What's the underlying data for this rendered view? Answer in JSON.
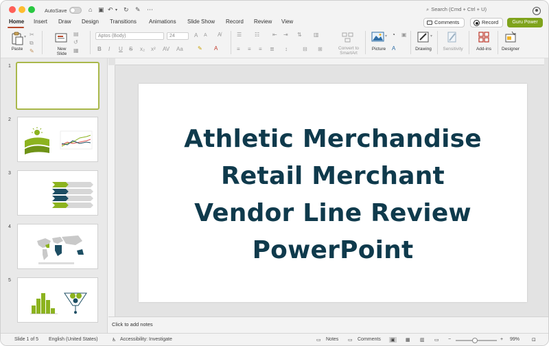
{
  "titlebar": {
    "autosave_label": "AutoSave",
    "search_placeholder": "Search (Cmd + Ctrl + U)"
  },
  "tabs": [
    {
      "label": "Home",
      "active": true
    },
    {
      "label": "Insert"
    },
    {
      "label": "Draw"
    },
    {
      "label": "Design"
    },
    {
      "label": "Transitions"
    },
    {
      "label": "Animations"
    },
    {
      "label": "Slide Show"
    },
    {
      "label": "Record"
    },
    {
      "label": "Review"
    },
    {
      "label": "View"
    }
  ],
  "actions": {
    "comments": "Comments",
    "record": "Record",
    "guru": "Guru Power",
    "guru_color": "#7fa31c"
  },
  "ribbon": {
    "paste": "Paste",
    "new_slide": "New\nSlide",
    "font_name": "Aptos (Body)",
    "font_size": "24",
    "convert_smartart": "Convert to\nSmartArt",
    "picture": "Picture",
    "drawing": "Drawing",
    "sensitivity": "Sensitivity",
    "addins": "Add-ins",
    "designer": "Designer"
  },
  "slides": [
    {
      "number": "1",
      "selected": true
    },
    {
      "number": "2"
    },
    {
      "number": "3"
    },
    {
      "number": "4"
    },
    {
      "number": "5"
    }
  ],
  "slide": {
    "title_lines": [
      "Athletic Merchandise",
      "Retail Merchant",
      "Vendor Line Review",
      "PowerPoint"
    ],
    "title_color": "#0f3a4c"
  },
  "notes_placeholder": "Click to add notes",
  "status": {
    "slide_position": "Slide 1 of 5",
    "language": "English (United States)",
    "accessibility": "Accessibility: Investigate",
    "notes": "Notes",
    "comments": "Comments",
    "zoom": "99%"
  }
}
